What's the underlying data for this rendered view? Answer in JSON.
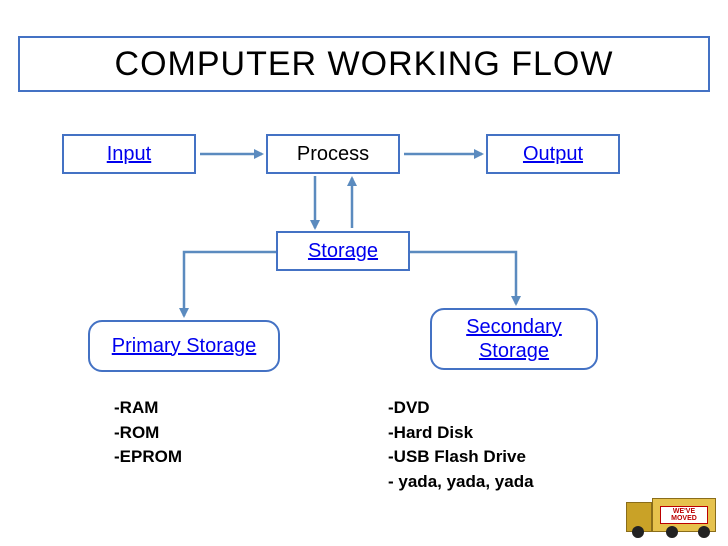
{
  "title": "COMPUTER WORKING FLOW",
  "nodes": {
    "input": "Input",
    "process": "Process",
    "output": "Output",
    "storage": "Storage",
    "primary": "Primary Storage",
    "secondary": "Secondary Storage"
  },
  "primary_items": {
    "i0": "RAM",
    "i1": "ROM",
    "i2": "EPROM"
  },
  "secondary_items": {
    "i0": "DVD",
    "i1": "Hard Disk",
    "i2": "USB Flash Drive",
    "i3": " yada, yada, yada"
  },
  "decor": {
    "truck_sign": "WE'VE MOVED"
  },
  "colors": {
    "border": "#4472c4",
    "arrow": "#5b8bbf",
    "link": "#0000ee"
  }
}
